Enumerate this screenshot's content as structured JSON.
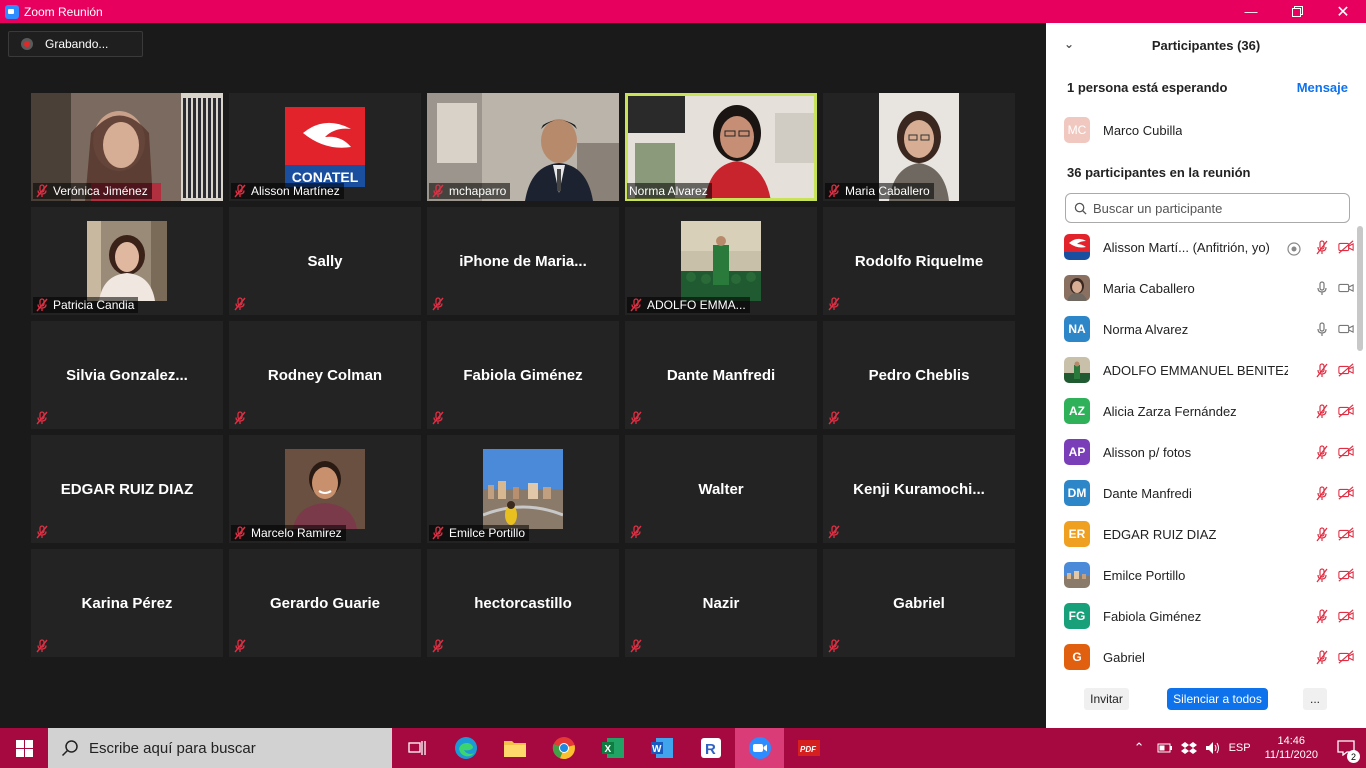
{
  "window": {
    "title": "Zoom Reunión"
  },
  "recording": {
    "label": "Grabando..."
  },
  "tiles": [
    {
      "name": "Verónica Jiménez",
      "kind": "video",
      "thumb": "office-woman"
    },
    {
      "name": "Alisson Martínez",
      "kind": "logo",
      "logo_text": "CONATEL"
    },
    {
      "name": "mchaparro",
      "kind": "video",
      "thumb": "man-suit"
    },
    {
      "name": "Norma Alvarez",
      "kind": "video",
      "thumb": "woman-red",
      "active": true
    },
    {
      "name": "Maria Caballero",
      "kind": "photo",
      "thumb": "woman-portrait"
    },
    {
      "name": "Patricia Candia",
      "kind": "photo",
      "thumb": "woman-photo"
    },
    {
      "name": "Sally",
      "kind": "text"
    },
    {
      "name": "iPhone  de  Maria...",
      "kind": "text"
    },
    {
      "name": "ADOLFO EMMA...",
      "kind": "photo",
      "thumb": "graduation"
    },
    {
      "name": "Rodolfo Riquelme",
      "kind": "text"
    },
    {
      "name": "Silvia  Gonzalez...",
      "kind": "text"
    },
    {
      "name": "Rodney Colman",
      "kind": "text"
    },
    {
      "name": "Fabiola Giménez",
      "kind": "text"
    },
    {
      "name": "Dante Manfredi",
      "kind": "text"
    },
    {
      "name": "Pedro Cheblis",
      "kind": "text"
    },
    {
      "name": "EDGAR RUIZ DIAZ",
      "kind": "text"
    },
    {
      "name": "Marcelo Ramirez",
      "kind": "photo",
      "thumb": "man-portrait"
    },
    {
      "name": "Emilce Portillo",
      "kind": "photo",
      "thumb": "city"
    },
    {
      "name": "Walter",
      "kind": "text"
    },
    {
      "name": "Kenji  Kuramochi...",
      "kind": "text"
    },
    {
      "name": "Karina Pérez",
      "kind": "text"
    },
    {
      "name": "Gerardo Guarie",
      "kind": "text"
    },
    {
      "name": "hectorcastillo",
      "kind": "text"
    },
    {
      "name": "Nazir",
      "kind": "text"
    },
    {
      "name": "Gabriel",
      "kind": "text"
    }
  ],
  "panel": {
    "title": "Participantes (36)",
    "waiting_text": "1 persona está esperando",
    "message_link": "Mensaje",
    "waiting_person": {
      "initials": "MC",
      "name": "Marco Cubilla",
      "color": "#f0c8c0"
    },
    "count_text": "36 participantes en la reunión",
    "search_placeholder": "Buscar un participante",
    "participants": [
      {
        "initials": "",
        "name": "Alisson Martí...  (Anfitrión, yo)",
        "avatar": "conatel",
        "mic": "muted",
        "cam": "off",
        "rec": true
      },
      {
        "initials": "",
        "name": "Maria Caballero",
        "avatar": "photo",
        "mic": "on",
        "cam": "on"
      },
      {
        "initials": "NA",
        "name": "Norma Alvarez",
        "color": "#2d86c8",
        "mic": "on",
        "cam": "on"
      },
      {
        "initials": "",
        "name": "ADOLFO EMMANUEL BENITEZ ...",
        "avatar": "graduation",
        "mic": "muted",
        "cam": "off"
      },
      {
        "initials": "AZ",
        "name": "Alicia Zarza Fernández",
        "color": "#2fb15a",
        "mic": "muted",
        "cam": "off"
      },
      {
        "initials": "AP",
        "name": "Alisson p/ fotos",
        "color": "#7a3fb8",
        "mic": "muted",
        "cam": "off"
      },
      {
        "initials": "DM",
        "name": "Dante Manfredi",
        "color": "#2d86c8",
        "mic": "muted",
        "cam": "off"
      },
      {
        "initials": "ER",
        "name": "EDGAR RUIZ DIAZ",
        "color": "#f0a020",
        "mic": "muted",
        "cam": "off"
      },
      {
        "initials": "",
        "name": "Emilce Portillo",
        "avatar": "city",
        "mic": "muted",
        "cam": "off"
      },
      {
        "initials": "FG",
        "name": "Fabiola Giménez",
        "color": "#18a07a",
        "mic": "muted",
        "cam": "off"
      },
      {
        "initials": "G",
        "name": "Gabriel",
        "color": "#e06010",
        "mic": "muted",
        "cam": "off"
      }
    ],
    "invite_label": "Invitar",
    "mute_all_label": "Silenciar a todos",
    "more_label": "..."
  },
  "taskbar": {
    "search_placeholder": "Escribe aquí para buscar",
    "lang": "ESP",
    "time": "14:46",
    "date": "11/11/2020",
    "notif_count": "2"
  },
  "colors": {
    "titlebar": "#e8005f",
    "taskbar": "#a5093f",
    "accent": "#0e72ed",
    "active_speaker": "#c8e35a"
  }
}
